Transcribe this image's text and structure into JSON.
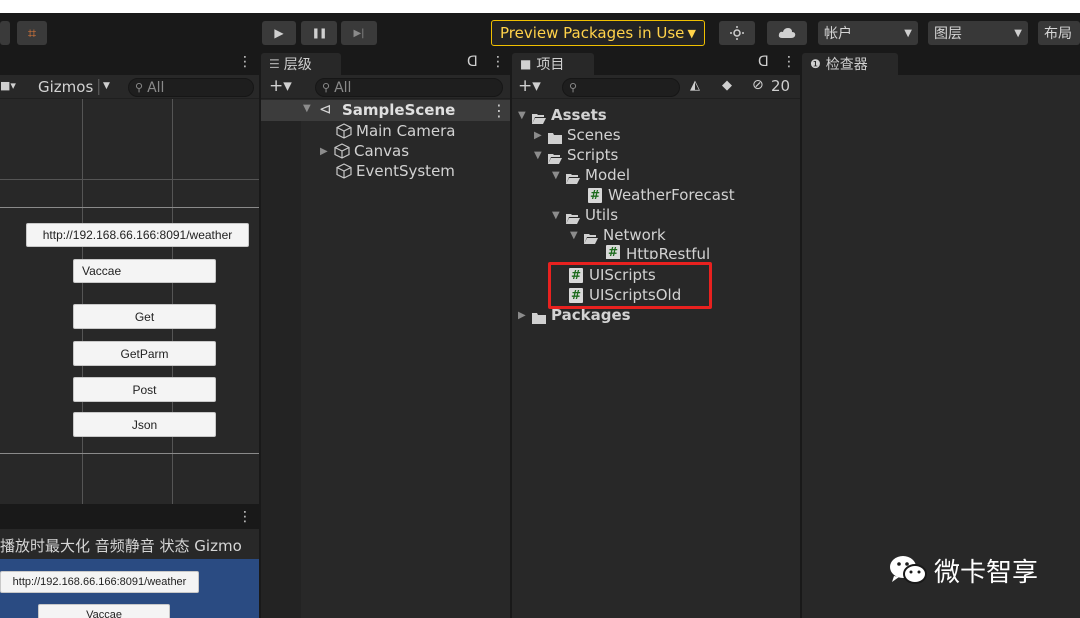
{
  "toolbar": {
    "collab_glyph": "⌗",
    "play_icon": "▶",
    "pause_icon": "❚❚",
    "step_icon": "▶|",
    "preview_label": "Preview Packages in Use",
    "account_label": "帐户",
    "layers_label": "图层",
    "layout_label": "布局"
  },
  "scene": {
    "gizmos_label": "Gizmos",
    "search_placeholder": "All",
    "url_field": "http://192.168.66.166:8091/weather",
    "name_field": "Vaccae",
    "buttons": [
      "Get",
      "GetParm",
      "Post",
      "Json"
    ]
  },
  "game": {
    "toolbar_text": "播放时最大化  音频静音  状态  Gizmo",
    "url_field": "http://192.168.66.166:8091/weather",
    "name_field": "Vaccae"
  },
  "hierarchy": {
    "tab_label": "层级",
    "search_placeholder": "All",
    "scene_name": "SampleScene",
    "items": [
      "Main Camera",
      "Canvas",
      "EventSystem"
    ]
  },
  "project": {
    "tab_label": "项目",
    "hidden_count": "20",
    "tree": {
      "assets": "Assets",
      "scenes": "Scenes",
      "scripts": "Scripts",
      "model": "Model",
      "weather": "WeatherForecast",
      "utils": "Utils",
      "network": "Network",
      "http": "HttpRestful",
      "uiscripts": "UIScripts",
      "uiscriptsold": "UIScriptsOld",
      "packages": "Packages"
    }
  },
  "inspector": {
    "tab_label": "检查器"
  },
  "watermark": {
    "text": "微卡智享"
  },
  "colors": {
    "accent_yellow": "#f0c000",
    "highlight_red": "#e8211f",
    "game_bg": "#2a4b82"
  }
}
